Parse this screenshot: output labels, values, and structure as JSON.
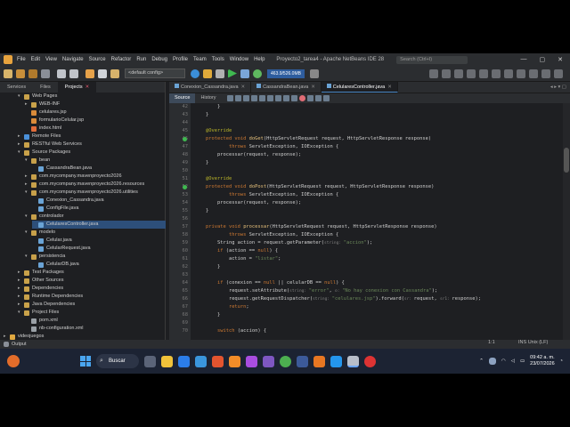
{
  "window": {
    "menu": [
      "File",
      "Edit",
      "View",
      "Navigate",
      "Source",
      "Refactor",
      "Run",
      "Debug",
      "Profile",
      "Team",
      "Tools",
      "Window",
      "Help"
    ],
    "title": "Proyecto2_tarea4 - Apache NetBeans IDE 28",
    "search_placeholder": "Search (Ctrl+I)",
    "controls": [
      "—",
      "▢",
      "✕"
    ]
  },
  "toolbar": {
    "config": "<default config>",
    "memory": "463.9/526.0MB"
  },
  "left_panel": {
    "tabs": [
      {
        "label": "Services",
        "active": false
      },
      {
        "label": "Files",
        "active": false
      },
      {
        "label": "Projects",
        "active": true
      }
    ],
    "tree": [
      {
        "label": "Web Pages",
        "indent": 2,
        "tog": "▾",
        "icon": "folder",
        "y": 0
      },
      {
        "label": "WEB-INF",
        "indent": 3,
        "tog": "▸",
        "icon": "folder",
        "y": 1
      },
      {
        "label": "celulares.jsp",
        "indent": 3,
        "tog": "",
        "icon": "jsp",
        "y": 2
      },
      {
        "label": "formularioCelular.jsp",
        "indent": 3,
        "tog": "",
        "icon": "jsp",
        "y": 3
      },
      {
        "label": "index.html",
        "indent": 3,
        "tog": "",
        "icon": "html",
        "y": 4
      },
      {
        "label": "Remote Files",
        "indent": 2,
        "tog": "▸",
        "icon": "globe",
        "y": 5
      },
      {
        "label": "RESTful Web Services",
        "indent": 2,
        "tog": "▸",
        "icon": "folder",
        "y": 6
      },
      {
        "label": "Source Packages",
        "indent": 2,
        "tog": "▾",
        "icon": "folder",
        "y": 7
      },
      {
        "label": "bean",
        "indent": 3,
        "tog": "▾",
        "icon": "pkg",
        "y": 8
      },
      {
        "label": "CassandraBean.java",
        "indent": 4,
        "tog": "",
        "icon": "java",
        "y": 9
      },
      {
        "label": "com.mycompany.mavenproyecto2026",
        "indent": 3,
        "tog": "▸",
        "icon": "pkg",
        "y": 10
      },
      {
        "label": "com.mycompany.mavenproyecto2026.resources",
        "indent": 3,
        "tog": "▸",
        "icon": "pkg",
        "y": 11
      },
      {
        "label": "com.mycompany.mavenproyecto2026.utilities",
        "indent": 3,
        "tog": "▾",
        "icon": "pkg",
        "y": 12
      },
      {
        "label": "Conexion_Cassandra.java",
        "indent": 4,
        "tog": "",
        "icon": "java",
        "y": 13
      },
      {
        "label": "ConfigFile.java",
        "indent": 4,
        "tog": "",
        "icon": "java",
        "y": 14
      },
      {
        "label": "controlador",
        "indent": 3,
        "tog": "▾",
        "icon": "pkg",
        "y": 15
      },
      {
        "label": "CelularesController.java",
        "indent": 4,
        "tog": "",
        "icon": "java",
        "y": 16,
        "selected": true
      },
      {
        "label": "modelo",
        "indent": 3,
        "tog": "▾",
        "icon": "pkg",
        "y": 17
      },
      {
        "label": "Celular.java",
        "indent": 4,
        "tog": "",
        "icon": "java",
        "y": 18
      },
      {
        "label": "CelularRequest.java",
        "indent": 4,
        "tog": "",
        "icon": "java",
        "y": 19
      },
      {
        "label": "persistencia",
        "indent": 3,
        "tog": "▾",
        "icon": "pkg",
        "y": 20
      },
      {
        "label": "CelularDB.java",
        "indent": 4,
        "tog": "",
        "icon": "java",
        "y": 21
      },
      {
        "label": "Test Packages",
        "indent": 2,
        "tog": "▸",
        "icon": "folder",
        "y": 22
      },
      {
        "label": "Other Sources",
        "indent": 2,
        "tog": "▸",
        "icon": "folder",
        "y": 23
      },
      {
        "label": "Dependencies",
        "indent": 2,
        "tog": "▸",
        "icon": "folder",
        "y": 24
      },
      {
        "label": "Runtime Dependencies",
        "indent": 2,
        "tog": "▸",
        "icon": "folder",
        "y": 25
      },
      {
        "label": "Java Dependencies",
        "indent": 2,
        "tog": "▸",
        "icon": "folder",
        "y": 26
      },
      {
        "label": "Project Files",
        "indent": 2,
        "tog": "▾",
        "icon": "folder",
        "y": 27
      },
      {
        "label": "pom.xml",
        "indent": 3,
        "tog": "",
        "icon": "xml",
        "y": 28
      },
      {
        "label": "nb-configuration.xml",
        "indent": 3,
        "tog": "",
        "icon": "xml",
        "y": 29
      },
      {
        "label": "videojuegos",
        "indent": 0,
        "tog": "▸",
        "icon": "proj",
        "y": 30
      }
    ]
  },
  "editor": {
    "tabs": [
      {
        "label": "Conexion_Cassandra.java",
        "active": false
      },
      {
        "label": "CassandraBean.java",
        "active": false
      },
      {
        "label": "CelularesController.java",
        "active": true
      }
    ],
    "modes": [
      "Source",
      "History"
    ],
    "lines": [
      {
        "n": "42",
        "parts": [
          [
            "",
            "        }"
          ]
        ]
      },
      {
        "n": "43",
        "parts": [
          [
            "",
            "    }"
          ]
        ]
      },
      {
        "n": "44",
        "parts": [
          [
            "",
            ""
          ]
        ]
      },
      {
        "n": "45",
        "parts": [
          [
            "an",
            "    @Override"
          ]
        ]
      },
      {
        "n": "46",
        "marker": true,
        "parts": [
          [
            "kw",
            "    protected void "
          ],
          [
            "fn",
            "doGet"
          ],
          [
            "",
            "(HttpServletRequest request, HttpServletResponse response)"
          ]
        ]
      },
      {
        "n": "47",
        "parts": [
          [
            "kw",
            "            throws "
          ],
          [
            "",
            "ServletException, IOException {"
          ]
        ]
      },
      {
        "n": "48",
        "parts": [
          [
            "",
            "        processar(request, response);"
          ]
        ]
      },
      {
        "n": "49",
        "parts": [
          [
            "",
            "    }"
          ]
        ]
      },
      {
        "n": "50",
        "parts": [
          [
            "",
            ""
          ]
        ]
      },
      {
        "n": "51",
        "parts": [
          [
            "an",
            "    @Override"
          ]
        ]
      },
      {
        "n": "52",
        "marker": true,
        "parts": [
          [
            "kw",
            "    protected void "
          ],
          [
            "fn",
            "doPost"
          ],
          [
            "",
            "(HttpServletRequest request, HttpServletResponse response)"
          ]
        ]
      },
      {
        "n": "53",
        "parts": [
          [
            "kw",
            "            throws "
          ],
          [
            "",
            "ServletException, IOException {"
          ]
        ]
      },
      {
        "n": "54",
        "parts": [
          [
            "",
            "        processar(request, response);"
          ]
        ]
      },
      {
        "n": "55",
        "parts": [
          [
            "",
            "    }"
          ]
        ]
      },
      {
        "n": "56",
        "parts": [
          [
            "",
            ""
          ]
        ]
      },
      {
        "n": "57",
        "parts": [
          [
            "kw",
            "    private void "
          ],
          [
            "fn",
            "processar"
          ],
          [
            "",
            "(HttpServletRequest request, HttpServletResponse response)"
          ]
        ]
      },
      {
        "n": "58",
        "parts": [
          [
            "kw",
            "            throws "
          ],
          [
            "",
            "ServletException, IOException {"
          ]
        ]
      },
      {
        "n": "59",
        "parts": [
          [
            "",
            "        String action = request.getParameter("
          ],
          [
            "hint",
            "string: "
          ],
          [
            "st",
            "\"accion\""
          ],
          [
            "",
            ");"
          ]
        ]
      },
      {
        "n": "60",
        "parts": [
          [
            "kw",
            "        if "
          ],
          [
            "",
            "(action == "
          ],
          [
            "kw",
            "null"
          ],
          [
            "",
            ") {"
          ]
        ]
      },
      {
        "n": "61",
        "parts": [
          [
            "",
            "            action = "
          ],
          [
            "st",
            "\"listar\""
          ],
          [
            "",
            ";"
          ]
        ]
      },
      {
        "n": "62",
        "parts": [
          [
            "",
            "        }"
          ]
        ]
      },
      {
        "n": "63",
        "parts": [
          [
            "",
            ""
          ]
        ]
      },
      {
        "n": "64",
        "parts": [
          [
            "kw",
            "        if "
          ],
          [
            "",
            "(conexion == "
          ],
          [
            "kw",
            "null"
          ],
          [
            "",
            " || celularDB == "
          ],
          [
            "kw",
            "null"
          ],
          [
            "",
            ") {"
          ]
        ]
      },
      {
        "n": "65",
        "parts": [
          [
            "",
            "            request.setAttribute("
          ],
          [
            "hint",
            "string: "
          ],
          [
            "st",
            "\"error\""
          ],
          [
            "",
            ", "
          ],
          [
            "hint",
            "o: "
          ],
          [
            "st",
            "\"No hay conexion con Cassandra\""
          ],
          [
            "",
            ");"
          ]
        ]
      },
      {
        "n": "66",
        "parts": [
          [
            "",
            "            request.getRequestDispatcher("
          ],
          [
            "hint",
            "string: "
          ],
          [
            "st",
            "\"celulares.jsp\""
          ],
          [
            "",
            ").forward("
          ],
          [
            "hint",
            "sr: "
          ],
          [
            "",
            "request, "
          ],
          [
            "hint",
            "sr1: "
          ],
          [
            "",
            "response);"
          ]
        ]
      },
      {
        "n": "67",
        "parts": [
          [
            "kw",
            "            return"
          ],
          [
            "",
            ";"
          ]
        ]
      },
      {
        "n": "68",
        "parts": [
          [
            "",
            "        }"
          ]
        ]
      },
      {
        "n": "69",
        "parts": [
          [
            "",
            ""
          ]
        ]
      },
      {
        "n": "70",
        "parts": [
          [
            "kw",
            "        switch "
          ],
          [
            "",
            "(accion) {"
          ]
        ]
      }
    ]
  },
  "output_label": "Output",
  "status": {
    "position": "1:1",
    "mode": "INS Unix (LF)"
  },
  "taskbar": {
    "search": "Buscar",
    "time": "09:42 a. m.",
    "date": "23/07/2026"
  }
}
